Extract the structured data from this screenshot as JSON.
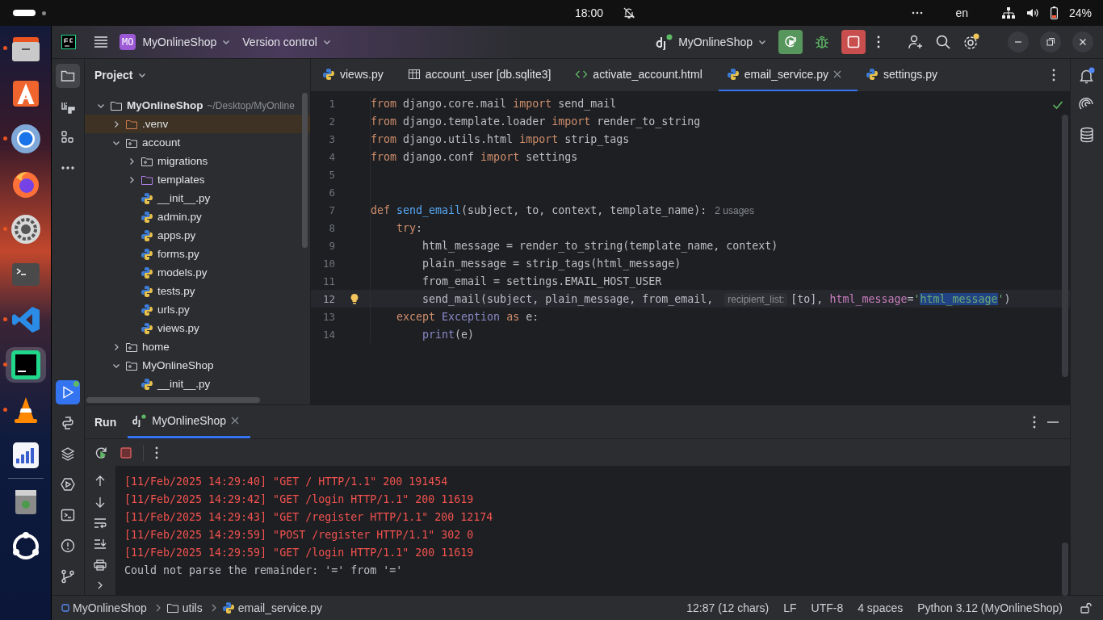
{
  "system_bar": {
    "time": "18:00",
    "language": "en",
    "battery": "24%"
  },
  "dock": [
    {
      "kind": "files",
      "running": true,
      "selected": false
    },
    {
      "kind": "appstore",
      "running": false,
      "selected": false
    },
    {
      "kind": "chrome",
      "running": true,
      "selected": false
    },
    {
      "kind": "firefox",
      "running": false,
      "selected": false
    },
    {
      "kind": "settings",
      "running": true,
      "selected": false
    },
    {
      "kind": "terminal",
      "running": false,
      "selected": false
    },
    {
      "kind": "vscode",
      "running": true,
      "selected": false
    },
    {
      "kind": "pycharm",
      "running": true,
      "selected": true
    },
    {
      "kind": "vlc",
      "running": true,
      "selected": false
    },
    {
      "kind": "monitor",
      "running": false,
      "selected": false
    },
    {
      "kind": "trash",
      "running": false,
      "selected": false
    },
    {
      "kind": "ubuntu",
      "running": false,
      "selected": false
    }
  ],
  "title_bar": {
    "project_badge": "MO",
    "project": "MyOnlineShop",
    "vcs": "Version control",
    "run_config": "MyOnlineShop"
  },
  "left_toolbar_top": [
    {
      "kind": "project",
      "selected": true
    },
    {
      "kind": "django",
      "selected": false
    },
    {
      "kind": "structure",
      "selected": false
    },
    {
      "kind": "more",
      "selected": false
    }
  ],
  "left_toolbar_bottom": [
    {
      "kind": "run",
      "selected": true
    },
    {
      "kind": "python_console",
      "selected": false
    },
    {
      "kind": "layers",
      "selected": false
    },
    {
      "kind": "services",
      "selected": false
    },
    {
      "kind": "terminal",
      "selected": false
    },
    {
      "kind": "problems",
      "selected": false
    },
    {
      "kind": "git",
      "selected": false
    }
  ],
  "project_panel": {
    "title": "Project",
    "tree": [
      {
        "name": "MyOnlineShop",
        "path": "~/Desktop/MyOnline",
        "kind": "folder",
        "expanded": true,
        "selected": false,
        "children": [
          {
            "name": ".venv",
            "kind": "venv",
            "expanded": false,
            "selected": true
          },
          {
            "name": "account",
            "kind": "package",
            "expanded": true,
            "selected": false,
            "children": [
              {
                "name": "migrations",
                "kind": "package",
                "expanded": false,
                "selected": false
              },
              {
                "name": "templates",
                "kind": "templates",
                "expanded": false,
                "selected": false
              },
              {
                "name": "__init__.py",
                "kind": "python",
                "selected": false
              },
              {
                "name": "admin.py",
                "kind": "python",
                "selected": false
              },
              {
                "name": "apps.py",
                "kind": "python",
                "selected": false
              },
              {
                "name": "forms.py",
                "kind": "python",
                "selected": false
              },
              {
                "name": "models.py",
                "kind": "python",
                "selected": false
              },
              {
                "name": "tests.py",
                "kind": "python",
                "selected": false
              },
              {
                "name": "urls.py",
                "kind": "python",
                "selected": false
              },
              {
                "name": "views.py",
                "kind": "python",
                "selected": false
              }
            ]
          },
          {
            "name": "home",
            "kind": "package",
            "expanded": false,
            "selected": false
          },
          {
            "name": "MyOnlineShop",
            "kind": "package",
            "expanded": true,
            "selected": false,
            "children": [
              {
                "name": "__init__.py",
                "kind": "python",
                "selected": false
              }
            ]
          }
        ]
      }
    ]
  },
  "editor": {
    "tabs": [
      {
        "label": "views.py",
        "kind": "python",
        "selected": false
      },
      {
        "label": "account_user [db.sqlite3]",
        "kind": "table",
        "selected": false
      },
      {
        "label": "activate_account.html",
        "kind": "html",
        "selected": false
      },
      {
        "label": "email_service.py",
        "kind": "python",
        "selected": true
      },
      {
        "label": "settings.py",
        "kind": "python",
        "selected": false
      }
    ],
    "lines": [
      {
        "number": "1",
        "current": false,
        "bulb": false,
        "tokens": [
          {
            "text": "from",
            "kind": "keyword"
          },
          {
            "text": " django.core.mail ",
            "kind": "plain"
          },
          {
            "text": "import",
            "kind": "keyword"
          },
          {
            "text": " send_mail",
            "kind": "plain"
          }
        ]
      },
      {
        "number": "2",
        "current": false,
        "bulb": false,
        "tokens": [
          {
            "text": "from",
            "kind": "keyword"
          },
          {
            "text": " django.template.loader ",
            "kind": "plain"
          },
          {
            "text": "import",
            "kind": "keyword"
          },
          {
            "text": " render_to_string",
            "kind": "plain"
          }
        ]
      },
      {
        "number": "3",
        "current": false,
        "bulb": false,
        "tokens": [
          {
            "text": "from",
            "kind": "keyword"
          },
          {
            "text": " django.utils.html ",
            "kind": "plain"
          },
          {
            "text": "import",
            "kind": "keyword"
          },
          {
            "text": " strip_tags",
            "kind": "plain"
          }
        ]
      },
      {
        "number": "4",
        "current": false,
        "bulb": false,
        "tokens": [
          {
            "text": "from",
            "kind": "keyword"
          },
          {
            "text": " django.conf ",
            "kind": "plain"
          },
          {
            "text": "import",
            "kind": "keyword"
          },
          {
            "text": " settings",
            "kind": "plain"
          }
        ]
      },
      {
        "number": "5",
        "current": false,
        "bulb": false
      },
      {
        "number": "6",
        "current": false,
        "bulb": false
      },
      {
        "number": "7",
        "current": false,
        "bulb": false,
        "tokens": [
          {
            "text": "def",
            "kind": "keyword"
          },
          {
            "text": " send_email",
            "kind": "function"
          },
          {
            "text": "(subject, to, context, template_name):",
            "kind": "plain"
          },
          {
            "text": "2 usages",
            "kind": "usages"
          }
        ]
      },
      {
        "number": "8",
        "current": false,
        "bulb": false,
        "tokens": [
          {
            "text": "    try",
            "kind": "keyword"
          },
          {
            "text": ":",
            "kind": "plain"
          }
        ]
      },
      {
        "number": "9",
        "current": false,
        "bulb": false,
        "tokens": [
          {
            "text": "        html_message = render_to_string(template_name, context)",
            "kind": "plain"
          }
        ]
      },
      {
        "number": "10",
        "current": false,
        "bulb": false,
        "tokens": [
          {
            "text": "        plain_message = strip_tags(html_message)",
            "kind": "plain"
          }
        ]
      },
      {
        "number": "11",
        "current": false,
        "bulb": false,
        "tokens": [
          {
            "text": "        from_email = settings.EMAIL_HOST_USER",
            "kind": "plain"
          }
        ]
      },
      {
        "number": "12",
        "current": true,
        "bulb": true,
        "tokens": [
          {
            "text": "        send_mail(subject, plain_message, from_email, ",
            "kind": "plain"
          },
          {
            "text": "recipient_list:",
            "kind": "hint"
          },
          {
            "text": "[to], ",
            "kind": "plain"
          },
          {
            "text": "html_message",
            "kind": "param"
          },
          {
            "text": "=",
            "kind": "plain"
          },
          {
            "text": "'",
            "kind": "string"
          },
          {
            "text": "html_message",
            "kind": "selected"
          },
          {
            "text": "'",
            "kind": "string"
          },
          {
            "text": ")",
            "kind": "plain"
          }
        ]
      },
      {
        "number": "13",
        "current": false,
        "bulb": false,
        "tokens": [
          {
            "text": "    except",
            "kind": "keyword"
          },
          {
            "text": " Exception",
            "kind": "builtin"
          },
          {
            "text": " as",
            "kind": "keyword"
          },
          {
            "text": " e:",
            "kind": "plain"
          }
        ]
      },
      {
        "number": "14",
        "current": false,
        "bulb": false,
        "tokens": [
          {
            "text": "        print",
            "kind": "builtin"
          },
          {
            "text": "(e)",
            "kind": "plain"
          }
        ]
      }
    ]
  },
  "run_panel": {
    "title": "Run",
    "tabs": [
      {
        "label": "MyOnlineShop",
        "selected": true
      }
    ],
    "console": [
      {
        "text": "[11/Feb/2025 14:29:40] \"GET / HTTP/1.1\" 200 191454",
        "kind": "error"
      },
      {
        "text": "[11/Feb/2025 14:29:42] \"GET /login HTTP/1.1\" 200 11619",
        "kind": "error"
      },
      {
        "text": "[11/Feb/2025 14:29:43] \"GET /register HTTP/1.1\" 200 12174",
        "kind": "error"
      },
      {
        "text": "[11/Feb/2025 14:29:59] \"POST /register HTTP/1.1\" 302 0",
        "kind": "error"
      },
      {
        "text": "[11/Feb/2025 14:29:59] \"GET /login HTTP/1.1\" 200 11619",
        "kind": "error"
      },
      {
        "text": "Could not parse the remainder: '=' from '='",
        "kind": "output"
      }
    ]
  },
  "status_bar": {
    "breadcrumbs": [
      {
        "label": "MyOnlineShop",
        "kind": "module"
      },
      {
        "label": "utils",
        "kind": "folder"
      },
      {
        "label": "email_service.py",
        "kind": "python"
      }
    ],
    "items": [
      "12:87 (12 chars)",
      "LF",
      "UTF-8",
      "4 spaces",
      "Python 3.12 (MyOnlineShop)"
    ]
  }
}
